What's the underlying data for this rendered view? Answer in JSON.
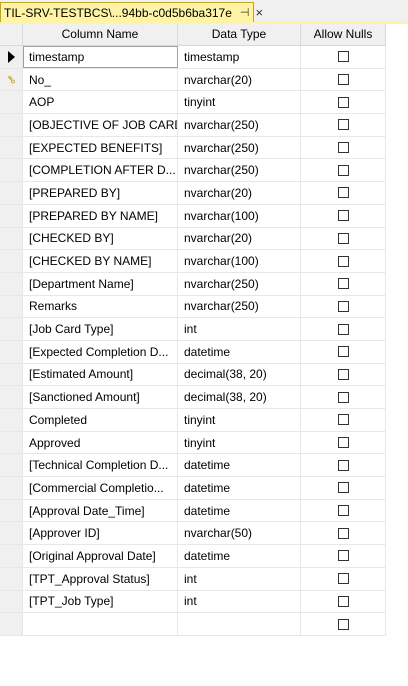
{
  "tab": {
    "title": "TIL-SRV-TESTBCS\\...94bb-c0d5b6ba317e",
    "pin_icon": "pin-icon",
    "pin_glyph": "⊣",
    "close_glyph": "×"
  },
  "grid": {
    "headers": {
      "column_name": "Column Name",
      "data_type": "Data Type",
      "allow_nulls": "Allow Nulls"
    },
    "rows": [
      {
        "name": "timestamp",
        "type": "timestamp",
        "allow_nulls": false,
        "marker": "current-row"
      },
      {
        "name": "No_",
        "type": "nvarchar(20)",
        "allow_nulls": false,
        "marker": "primary-key"
      },
      {
        "name": "AOP",
        "type": "tinyint",
        "allow_nulls": false
      },
      {
        "name": "[OBJECTIVE OF JOB CARD]",
        "type": "nvarchar(250)",
        "allow_nulls": false
      },
      {
        "name": "[EXPECTED BENEFITS]",
        "type": "nvarchar(250)",
        "allow_nulls": false
      },
      {
        "name": "[COMPLETION AFTER D...",
        "type": "nvarchar(250)",
        "allow_nulls": false
      },
      {
        "name": "[PREPARED BY]",
        "type": "nvarchar(20)",
        "allow_nulls": false
      },
      {
        "name": "[PREPARED BY NAME]",
        "type": "nvarchar(100)",
        "allow_nulls": false
      },
      {
        "name": "[CHECKED BY]",
        "type": "nvarchar(20)",
        "allow_nulls": false
      },
      {
        "name": "[CHECKED BY NAME]",
        "type": "nvarchar(100)",
        "allow_nulls": false
      },
      {
        "name": "[Department Name]",
        "type": "nvarchar(250)",
        "allow_nulls": false
      },
      {
        "name": "Remarks",
        "type": "nvarchar(250)",
        "allow_nulls": false
      },
      {
        "name": "[Job Card Type]",
        "type": "int",
        "allow_nulls": false
      },
      {
        "name": "[Expected Completion D...",
        "type": "datetime",
        "allow_nulls": false
      },
      {
        "name": "[Estimated Amount]",
        "type": "decimal(38, 20)",
        "allow_nulls": false
      },
      {
        "name": "[Sanctioned Amount]",
        "type": "decimal(38, 20)",
        "allow_nulls": false
      },
      {
        "name": "Completed",
        "type": "tinyint",
        "allow_nulls": false
      },
      {
        "name": "Approved",
        "type": "tinyint",
        "allow_nulls": false
      },
      {
        "name": "[Technical Completion D...",
        "type": "datetime",
        "allow_nulls": false
      },
      {
        "name": "[Commercial Completio...",
        "type": "datetime",
        "allow_nulls": false
      },
      {
        "name": "[Approval Date_Time]",
        "type": "datetime",
        "allow_nulls": false
      },
      {
        "name": "[Approver ID]",
        "type": "nvarchar(50)",
        "allow_nulls": false
      },
      {
        "name": "[Original Approval Date]",
        "type": "datetime",
        "allow_nulls": false
      },
      {
        "name": "[TPT_Approval Status]",
        "type": "int",
        "allow_nulls": false
      },
      {
        "name": "[TPT_Job Type]",
        "type": "int",
        "allow_nulls": false
      },
      {
        "name": "",
        "type": "",
        "allow_nulls": false
      }
    ]
  },
  "colors": {
    "tab_active": "#fff3a6",
    "tab_border": "#c9a600",
    "header_bg": "#f0f0f0",
    "key_icon": "#c8a000"
  }
}
